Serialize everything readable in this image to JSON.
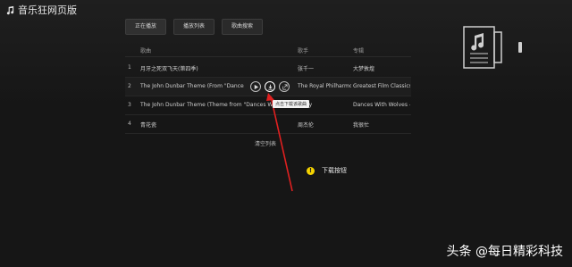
{
  "app": {
    "title": "音乐狂网页版",
    "icon": "music-note-icon"
  },
  "tabs": [
    {
      "label": "正在播放"
    },
    {
      "label": "播放列表"
    },
    {
      "label": "歌曲搜索"
    }
  ],
  "table": {
    "headers": {
      "song": "歌曲",
      "artist": "歌手",
      "album": "专辑"
    },
    "rows": [
      {
        "index": "1",
        "title": "月牙之死双飞天(第四季)",
        "artist": "张千一",
        "album": "大梦敦煌"
      },
      {
        "index": "2",
        "title": "The John Dunbar Theme (From \"Dances wit...",
        "artist": "The Royal Philharmonic...",
        "album": "Greatest Film Classics"
      },
      {
        "index": "3",
        "title": "The John Dunbar Theme (Theme from \"Dances With Wolves\")",
        "artist": "Barry",
        "album": "Dances With Wolves -..."
      },
      {
        "index": "4",
        "title": "青花瓷",
        "artist": "周杰伦",
        "album": "我很忙"
      }
    ],
    "row_actions": [
      "play-icon",
      "download-icon",
      "share-icon"
    ],
    "clear_label": "清空列表"
  },
  "tooltip": "点击下载该歌曲",
  "annotation": {
    "label": "下载按钮",
    "marker": "!"
  },
  "watermark": "头条 @每日精彩科技",
  "colors": {
    "background": "#161616",
    "arrow": "#e02020",
    "bulb": "#f5d300"
  }
}
